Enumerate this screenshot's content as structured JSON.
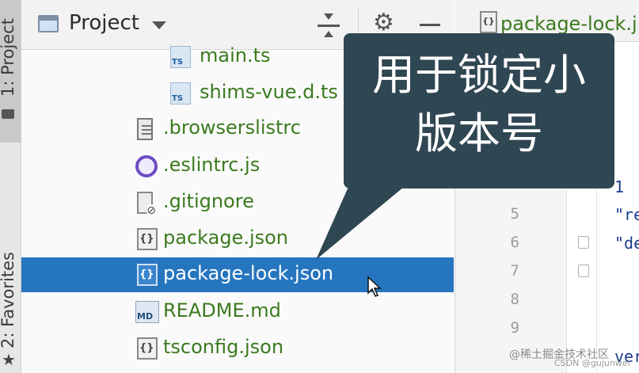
{
  "tool_strip": {
    "project_tab": "1: Project",
    "favorites_tab": "2: Favorites"
  },
  "panel_header": {
    "title": "Project",
    "icons": [
      "project-icon",
      "chevron-down-icon",
      "collapse-all-icon",
      "gear-icon",
      "minimize-icon"
    ]
  },
  "tree": {
    "items": [
      {
        "label": "main.ts",
        "icon": "typescript-file-icon"
      },
      {
        "label": "shims-vue.d.ts",
        "icon": "typescript-file-icon"
      },
      {
        "label": ".browserslistrc",
        "icon": "text-file-icon"
      },
      {
        "label": ".eslintrc.js",
        "icon": "eslint-icon"
      },
      {
        "label": ".gitignore",
        "icon": "gitignore-file-icon"
      },
      {
        "label": "package.json",
        "icon": "json-file-icon"
      },
      {
        "label": "package-lock.json",
        "icon": "json-file-icon",
        "selected": true
      },
      {
        "label": "README.md",
        "icon": "markdown-file-icon"
      },
      {
        "label": "tsconfig.json",
        "icon": "json-file-icon"
      }
    ]
  },
  "editor": {
    "tab_label": "package-lock.j",
    "line_numbers": [
      "5",
      "6",
      "7",
      "8",
      "9"
    ],
    "code_fragments": [
      "1",
      "\"re",
      "\"de",
      "ver"
    ]
  },
  "callout": {
    "line1": "用于锁定小",
    "line2": "版本号"
  },
  "watermark": {
    "text": "@稀土掘金技术社区",
    "sub": "CSDN @gujunwei"
  },
  "colors": {
    "selection": "#2675bf",
    "file_name": "#3b7a1f",
    "callout_bg": "#2f4653"
  }
}
